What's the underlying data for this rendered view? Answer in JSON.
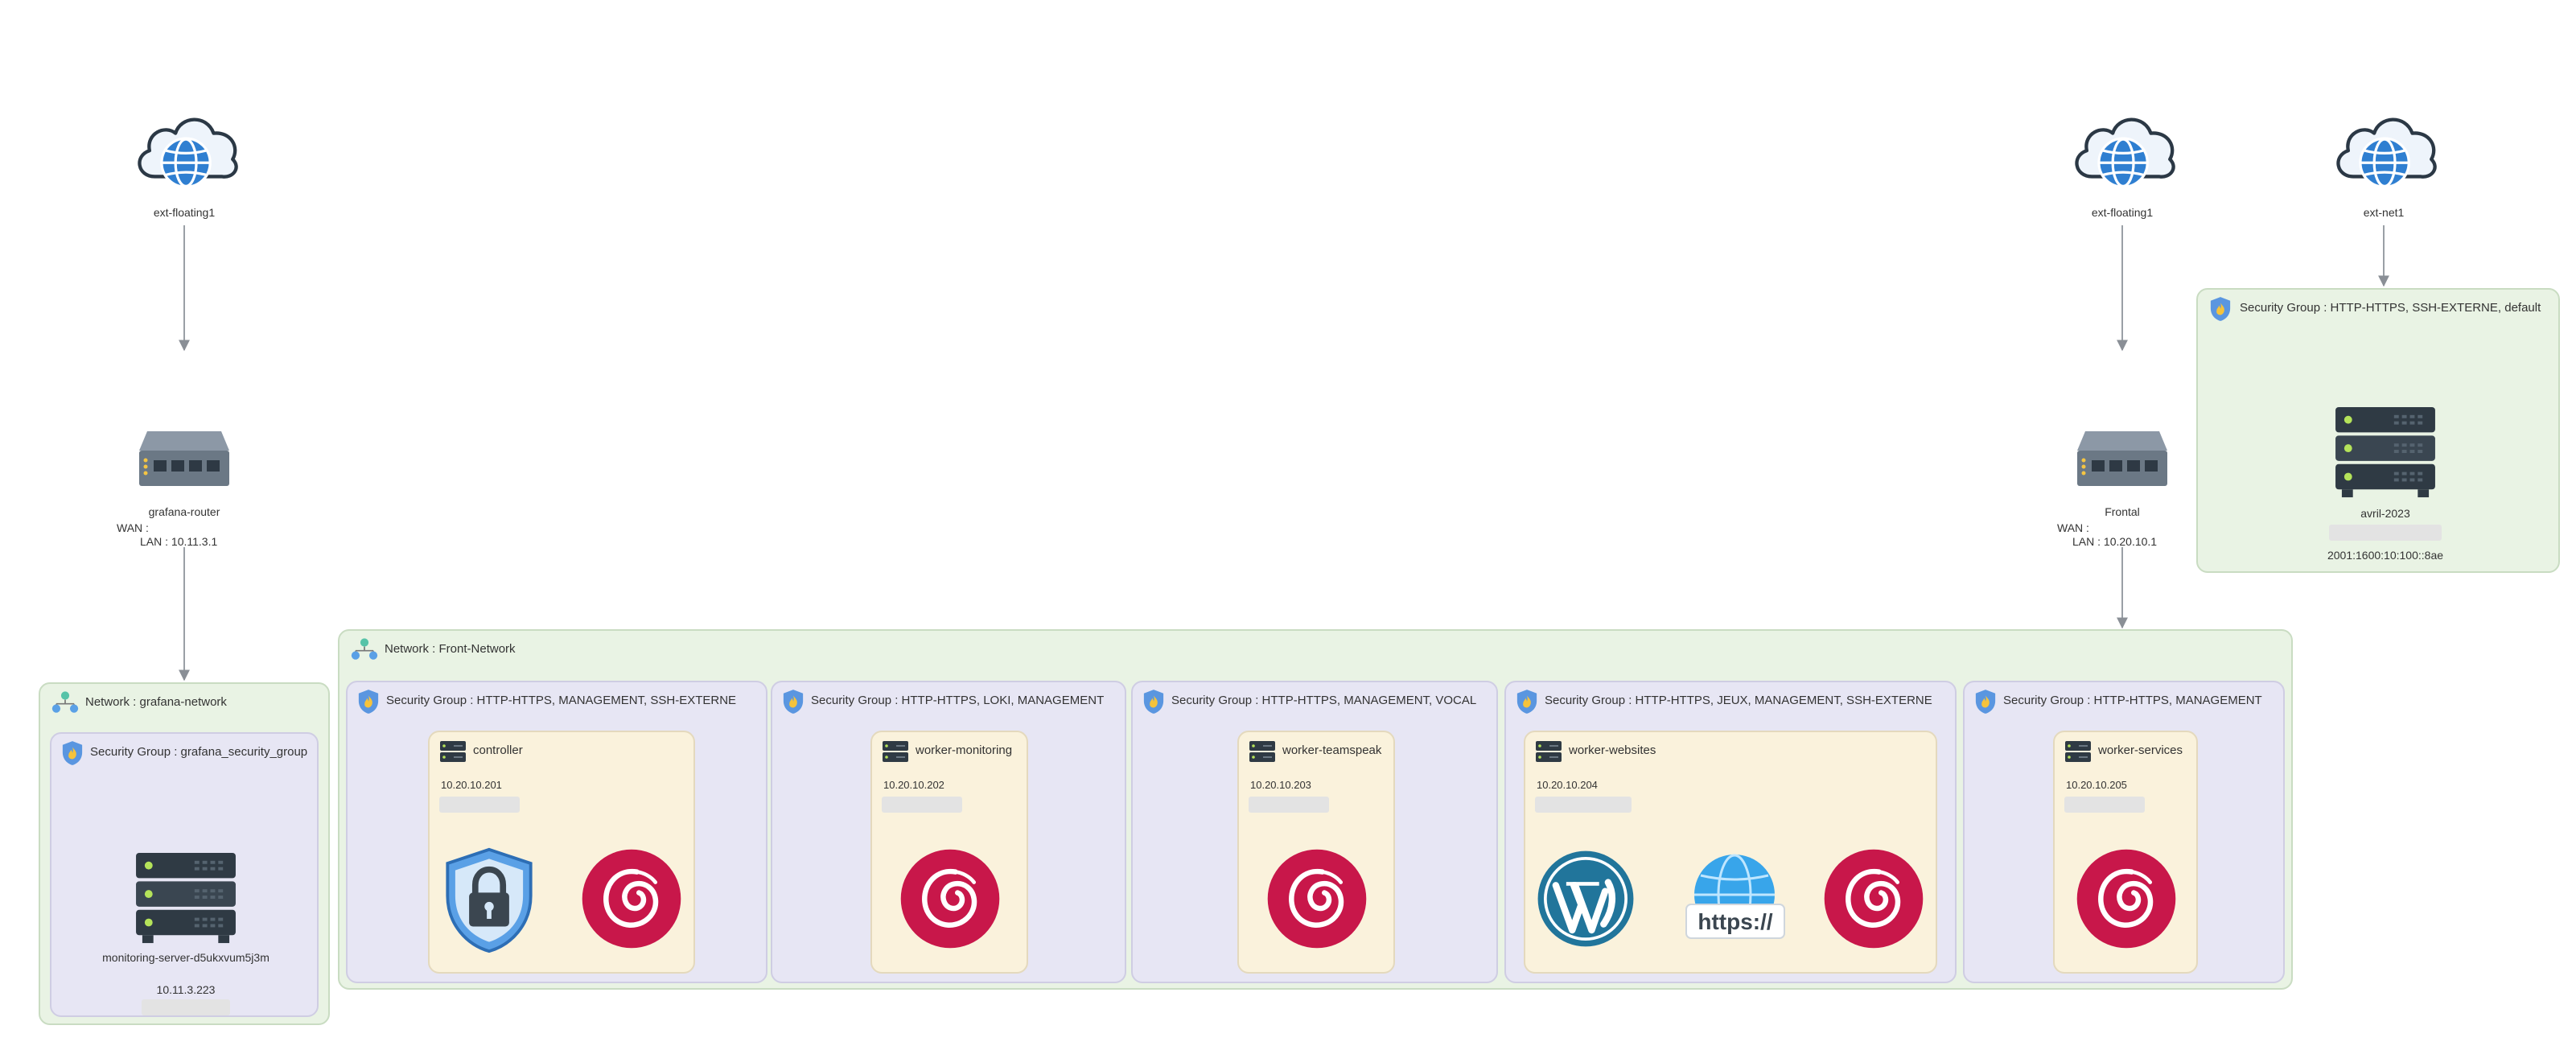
{
  "clouds": {
    "left": "ext-floating1",
    "mid": "ext-floating1",
    "right": "ext-net1"
  },
  "routers": {
    "grafana": {
      "name": "grafana-router",
      "wan": "WAN :",
      "lan": "LAN : 10.11.3.1"
    },
    "frontal": {
      "name": "Frontal",
      "wan": "WAN :",
      "lan": "LAN : 10.20.10.1"
    }
  },
  "networks": {
    "grafana": "Network : grafana-network",
    "front": "Network : Front-Network"
  },
  "groups": {
    "grafana": "Security Group : grafana_security_group",
    "controller": "Security Group : HTTP-HTTPS, MANAGEMENT, SSH-EXTERNE",
    "monitoring": "Security Group : HTTP-HTTPS, LOKI, MANAGEMENT",
    "teamspeak": "Security Group : HTTP-HTTPS, MANAGEMENT, VOCAL",
    "websites": "Security Group : HTTP-HTTPS, JEUX, MANAGEMENT, SSH-EXTERNE",
    "services": "Security Group : HTTP-HTTPS, MANAGEMENT",
    "avril": "Security Group : HTTP-HTTPS, SSH-EXTERNE, default"
  },
  "servers": {
    "monitoring_server": {
      "name": "monitoring-server-d5ukxvum5j3m",
      "ip": "10.11.3.223"
    },
    "avril": {
      "name": "avril-2023",
      "ip": "2001:1600:10:100::8ae"
    }
  },
  "vms": {
    "controller": {
      "name": "controller",
      "ip": "10.20.10.201"
    },
    "monitoring": {
      "name": "worker-monitoring",
      "ip": "10.20.10.202"
    },
    "teamspeak": {
      "name": "worker-teamspeak",
      "ip": "10.20.10.203"
    },
    "websites": {
      "name": "worker-websites",
      "ip": "10.20.10.204"
    },
    "services": {
      "name": "worker-services",
      "ip": "10.20.10.205"
    }
  },
  "icons": {
    "cloud": "cloud-globe-icon",
    "router": "router-switch-icon",
    "server": "server-rack-icon",
    "network": "network-icon",
    "security": "shield-flame-icon",
    "vm": "vm-server-icon",
    "debian": "debian-logo-icon",
    "lock_shield": "lock-shield-icon",
    "wordpress": "wordpress-logo-icon",
    "https": "https-globe-icon"
  },
  "https_text": "https://",
  "colors": {
    "network_bg": "#e9f3e4",
    "security_bg": "#e7e6f4",
    "vm_bg": "#faf2dc",
    "debian": "#c8174a",
    "wordpress": "#21759b",
    "shield_blue": "#5aa0e6"
  }
}
